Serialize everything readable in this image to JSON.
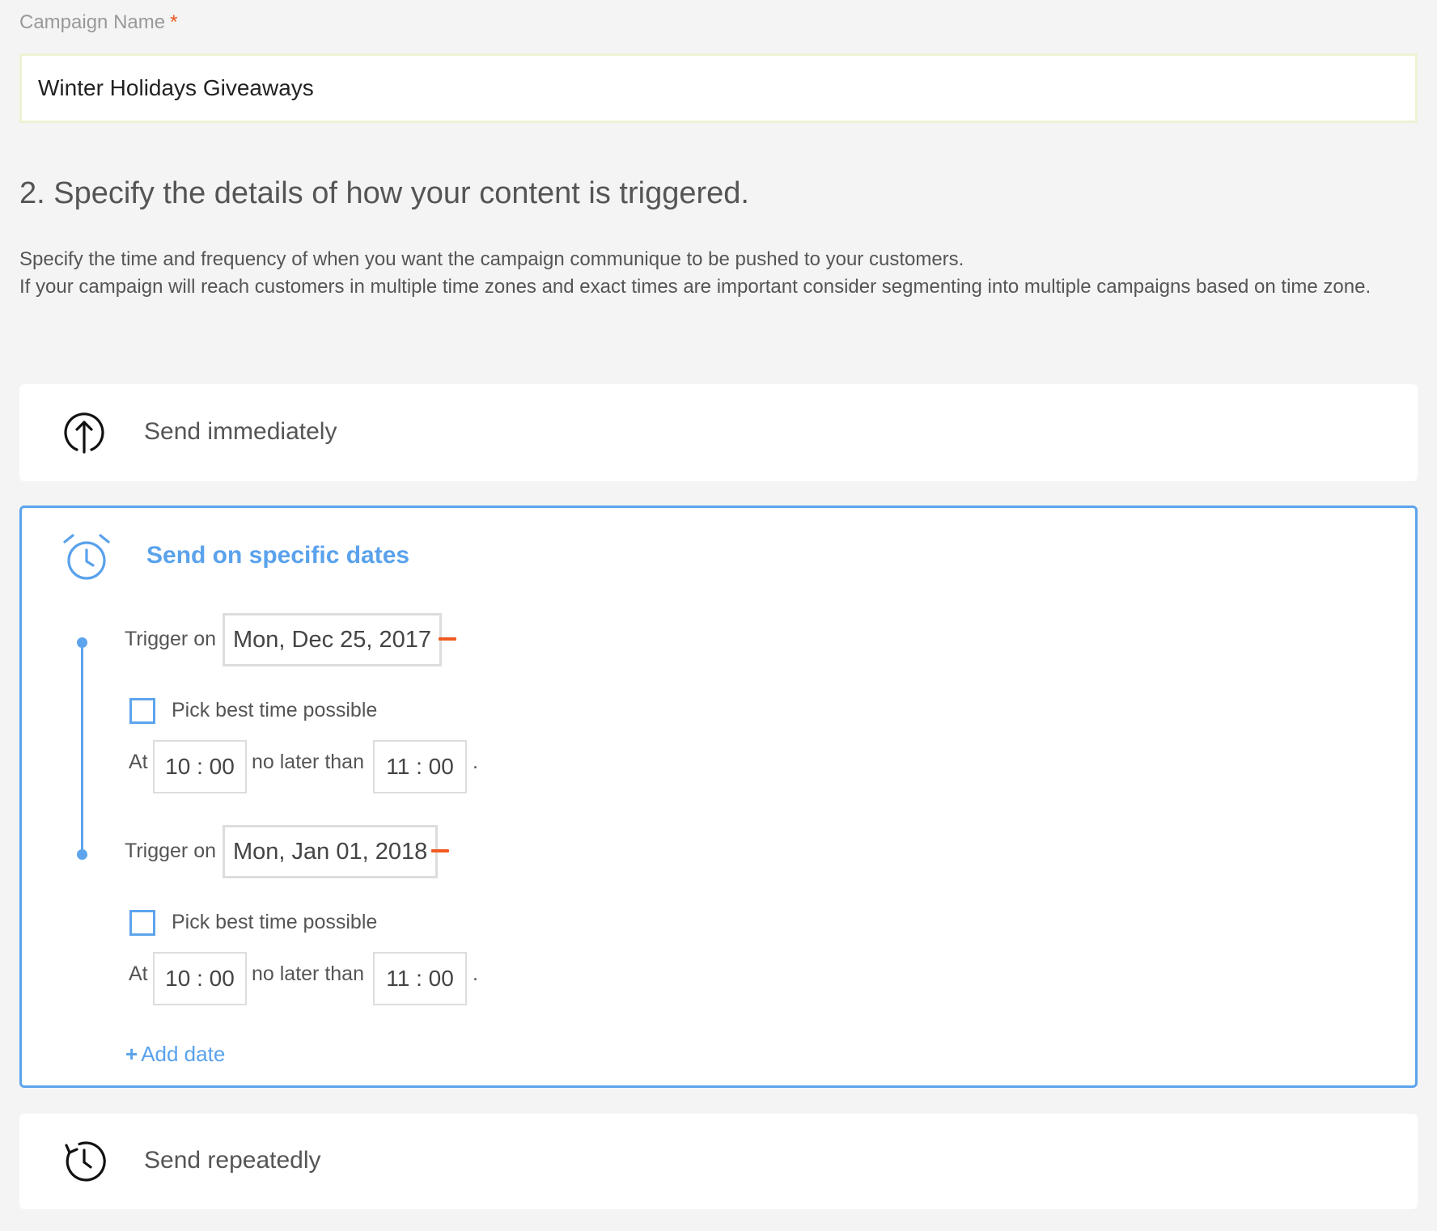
{
  "campaign_name": {
    "label": "Campaign Name",
    "required_mark": "*",
    "value": "Winter Holidays Giveaways"
  },
  "section": {
    "title": "2. Specify the details of how your content is triggered.",
    "description_line1": "Specify the time and frequency of when you want the campaign communique to be pushed to your customers.",
    "description_line2": "If your campaign will reach customers in multiple time zones and exact times are important consider segmenting into multiple campaigns based on time zone."
  },
  "options": {
    "immediate": {
      "label": "Send immediately",
      "icon": "arrow-up-circle-icon"
    },
    "specific_dates": {
      "label": "Send on specific dates",
      "icon": "alarm-clock-icon",
      "accent_color": "#5aa2ec",
      "entries": [
        {
          "trigger_label": "Trigger on",
          "date": "Mon, Dec 25, 2017",
          "pick_best_label": "Pick best time possible",
          "pick_best_checked": false,
          "at_label": "At",
          "start_time": "10 : 00",
          "no_later_label": "no later than",
          "end_time": "11 : 00",
          "period": "."
        },
        {
          "trigger_label": "Trigger on",
          "date": "Mon, Jan 01, 2018",
          "pick_best_label": "Pick best time possible",
          "pick_best_checked": false,
          "at_label": "At",
          "start_time": "10 : 00",
          "no_later_label": "no later than",
          "end_time": "11 : 00",
          "period": "."
        }
      ],
      "add_date_label": "Add date",
      "add_date_plus": "+"
    },
    "repeatedly": {
      "label": "Send repeatedly",
      "icon": "history-clock-icon"
    }
  },
  "colors": {
    "accent": "#5da4ec",
    "remove": "#f05a22",
    "required": "#e8541c"
  }
}
